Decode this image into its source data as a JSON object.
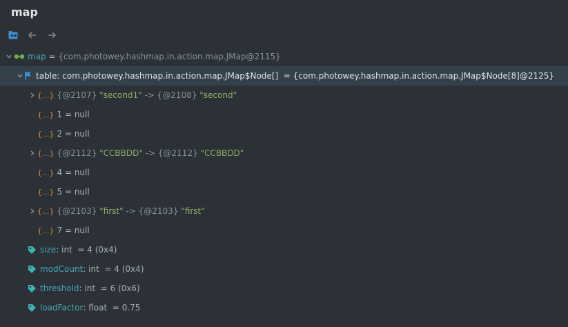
{
  "panel": {
    "title": "map"
  },
  "tree": {
    "map": {
      "name": "map",
      "eq": " = ",
      "value": "{com.photowey.hashmap.in.action.map.JMap@2115}"
    },
    "table": {
      "name": "table: com.photowey.hashmap.in.action.map.JMap$Node[]",
      "eq": "  = ",
      "value": "{com.photowey.hashmap.in.action.map.JMap$Node[8]@2125}"
    },
    "obj_icon": "{...}",
    "entries": [
      {
        "ref": "{@2107}",
        "key": "\"second1\"",
        "arrow": " -> ",
        "vref": "{@2108}",
        "val": "\"second\""
      },
      {
        "label": "1 = null"
      },
      {
        "label": "2 = null"
      },
      {
        "ref": "{@2112}",
        "key": "\"CCBBDD\"",
        "arrow": " -> ",
        "vref": "{@2112}",
        "val": "\"CCBBDD\""
      },
      {
        "label": "4 = null"
      },
      {
        "label": "5 = null"
      },
      {
        "ref": "{@2103}",
        "key": "\"first\"",
        "arrow": " -> ",
        "vref": "{@2103}",
        "val": "\"first\""
      },
      {
        "label": "7 = null"
      }
    ],
    "fields": [
      {
        "name": "size",
        "type": ": int",
        "value": "  = 4 (0x4)"
      },
      {
        "name": "modCount",
        "type": ": int",
        "value": "  = 4 (0x4)"
      },
      {
        "name": "threshold",
        "type": ": int",
        "value": "  = 6 (0x6)"
      },
      {
        "name": "loadFactor",
        "type": ": float",
        "value": "  = 0.75"
      }
    ]
  },
  "colors": {
    "background": "#2b3136",
    "selected_row": "#34414a",
    "field_name": "#47a7b2",
    "string": "#8fae6a",
    "object_icon": "#d18a3f"
  },
  "icons": [
    "restore-layout-icon",
    "back-arrow-icon",
    "forward-arrow-icon",
    "glasses-icon",
    "flag-icon",
    "tag-icon",
    "chevron-right-icon",
    "chevron-down-icon"
  ]
}
